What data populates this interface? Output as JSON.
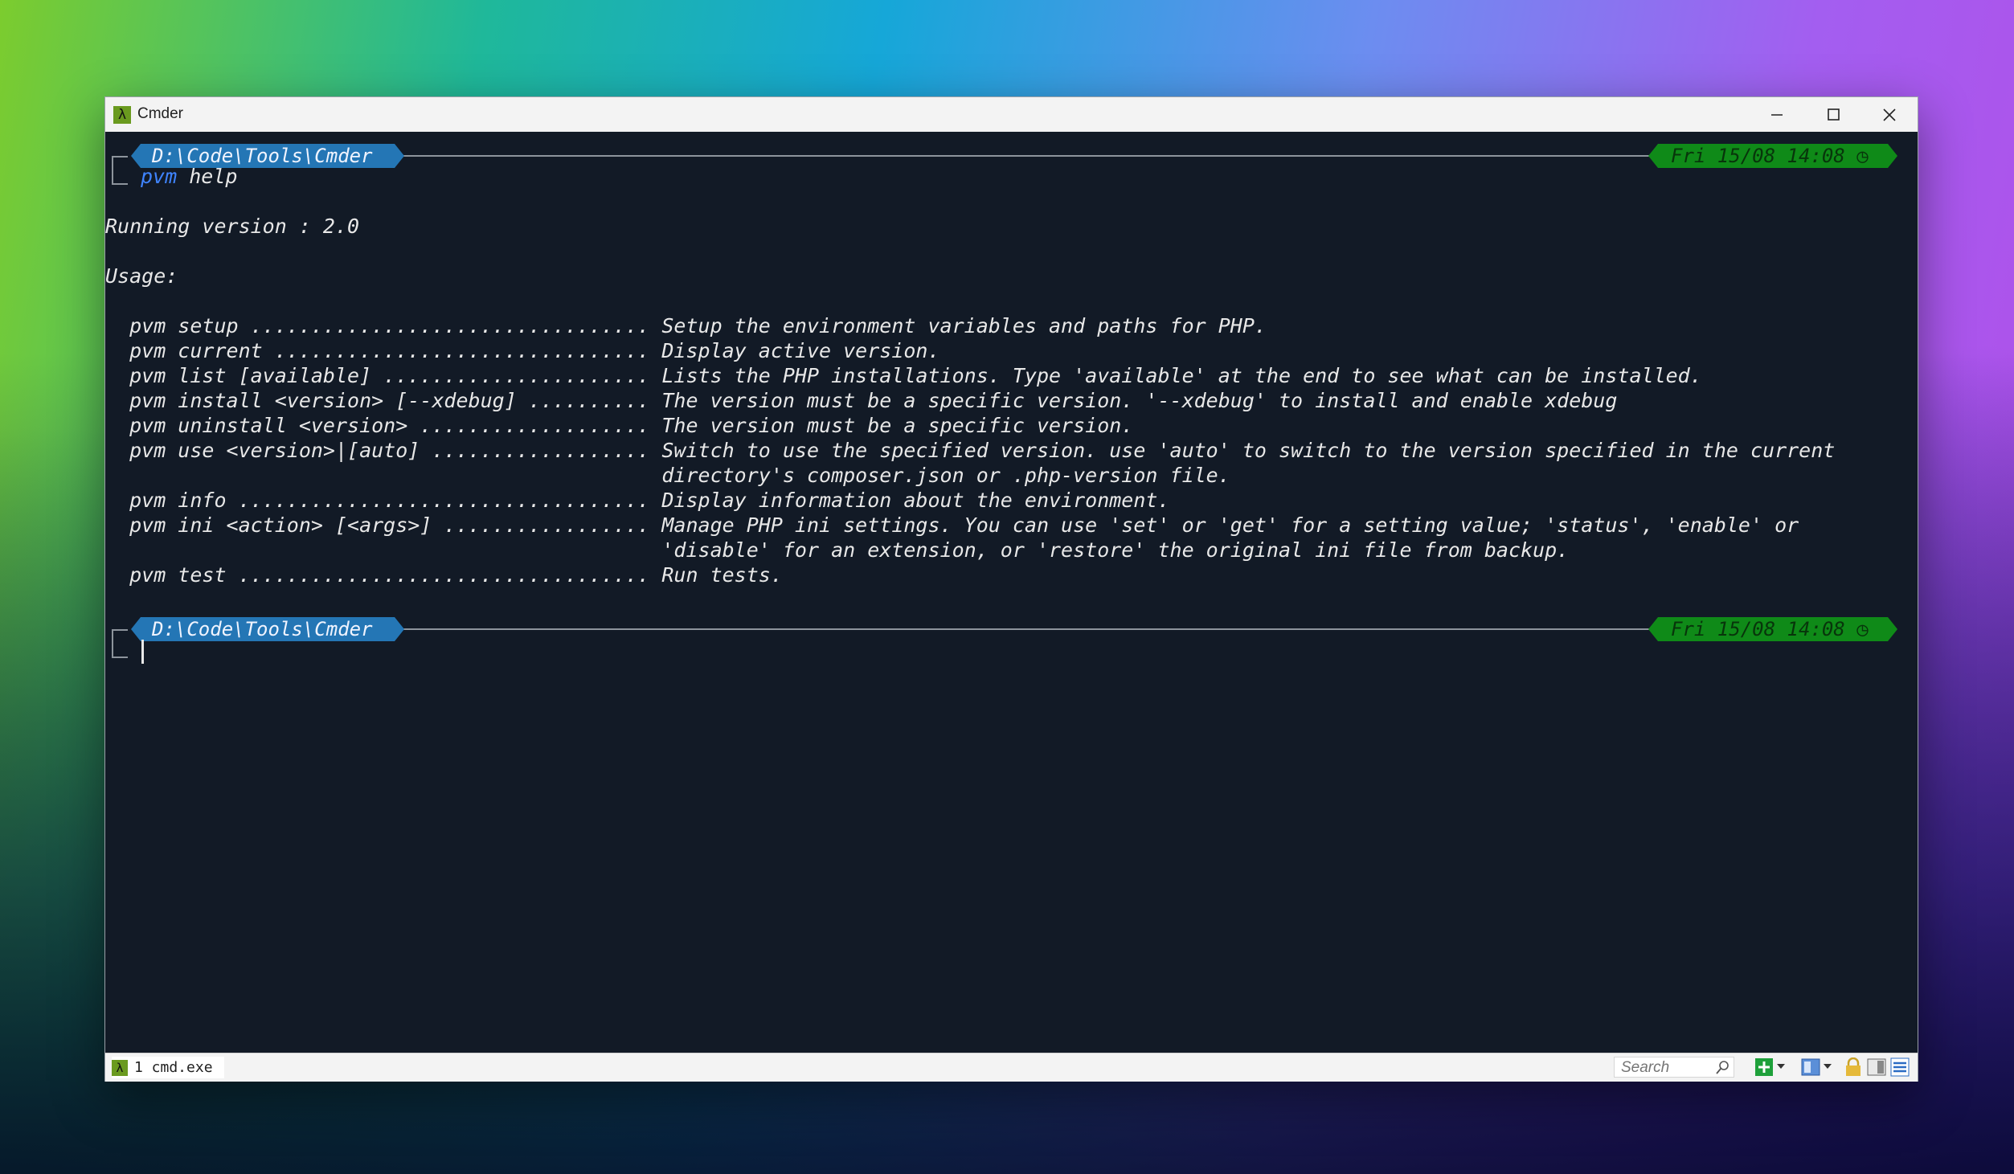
{
  "window": {
    "title": "Cmder",
    "app_icon_glyph": "λ",
    "controls": [
      "minimize-icon",
      "maximize-icon",
      "close-icon"
    ]
  },
  "console": {
    "prompt1": {
      "path": "D:\\Code\\Tools\\Cmder",
      "time": "Fri 15/08 14:08",
      "clock_glyph": "◷",
      "command_name": "pvm",
      "command_args": "help"
    },
    "output": [
      "Running version : 2.0",
      "",
      "Usage:",
      "",
      "  pvm setup ................................. Setup the environment variables and paths for PHP.",
      "  pvm current ............................... Display active version.",
      "  pvm list [available] ...................... Lists the PHP installations. Type 'available' at the end to see what can be installed.",
      "  pvm install <version> [--xdebug] .......... The version must be a specific version. '--xdebug' to install and enable xdebug",
      "  pvm uninstall <version> ................... The version must be a specific version.",
      "  pvm use <version>|[auto] .................. Switch to use the specified version. use 'auto' to switch to the version specified in the current",
      "                                              directory's composer.json or .php-version file.",
      "  pvm info .................................. Display information about the environment.",
      "  pvm ini <action> [<args>] ................. Manage PHP ini settings. You can use 'set' or 'get' for a setting value; 'status', 'enable' or",
      "                                              'disable' for an extension, or 'restore' the original ini file from backup.",
      "  pvm test .................................. Run tests."
    ],
    "prompt2": {
      "path": "D:\\Code\\Tools\\Cmder",
      "time": "Fri 15/08 14:08",
      "clock_glyph": "◷"
    }
  },
  "statusbar": {
    "tab_icon_glyph": "λ",
    "tab_label": "1 cmd.exe",
    "search_placeholder": "Search",
    "icons": [
      "search-icon",
      "add-tab-icon",
      "dropdown-icon",
      "split-view-icon",
      "dropdown-icon",
      "lock-icon",
      "panel-icon",
      "menu-icon"
    ]
  },
  "colors": {
    "console_bg": "#121a26",
    "path_segment": "#2476b5",
    "time_segment": "#0f8a18",
    "command_color": "#3f84ff"
  }
}
